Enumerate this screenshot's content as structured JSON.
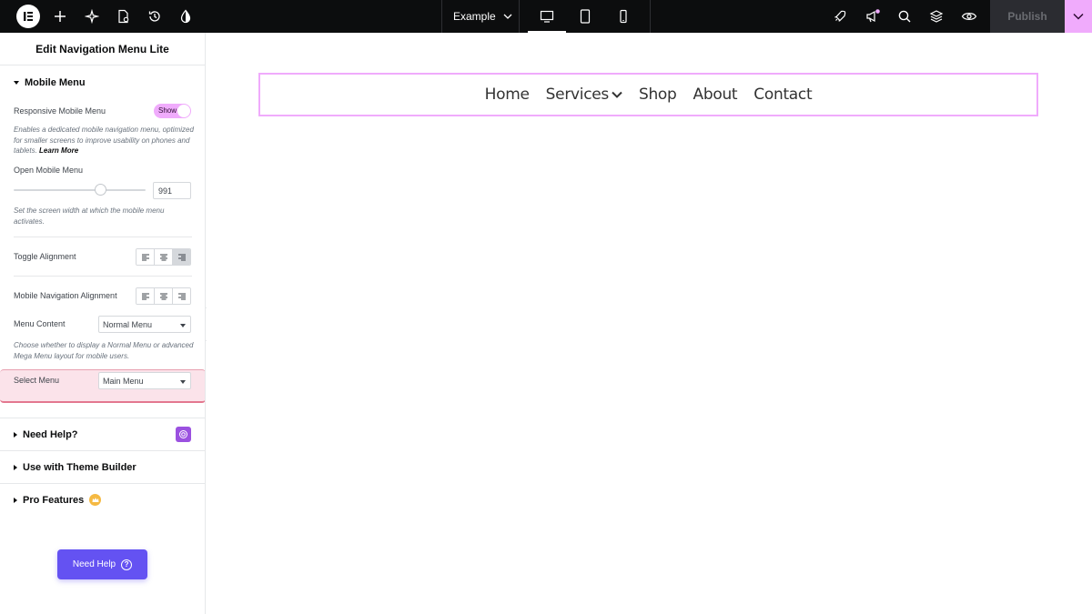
{
  "topbar": {
    "page_name": "Example",
    "publish_label": "Publish",
    "icons": [
      "elementor-logo-icon",
      "add-element-icon",
      "ai-sparkle-icon",
      "page-settings-icon",
      "history-icon",
      "site-settings-icon"
    ],
    "right_icons": [
      "rocket-icon",
      "announcements-icon",
      "search-icon",
      "structure-icon",
      "preview-icon"
    ],
    "devices": [
      "desktop-icon",
      "tablet-icon",
      "mobile-icon"
    ],
    "active_device": "desktop",
    "accent": "#f0abfc"
  },
  "panel": {
    "title": "Edit Navigation Menu Lite",
    "mobile_menu": {
      "title": "Mobile Menu",
      "responsive_label": "Responsive Mobile Menu",
      "responsive_toggle": "Show",
      "responsive_help": "Enables a dedicated mobile navigation menu, optimized for smaller screens to improve usability on phones and tablets.",
      "learn_more": "Learn More",
      "open_label": "Open Mobile Menu",
      "open_value": "991",
      "open_help": "Set the screen width at which the mobile menu activates.",
      "toggle_alignment_label": "Toggle Alignment",
      "toggle_alignment_active": "right",
      "mobile_nav_alignment_label": "Mobile Navigation Alignment",
      "menu_content_label": "Menu Content",
      "menu_content_value": "Normal Menu",
      "menu_content_help": "Choose whether to display a Normal Menu or advanced Mega Menu layout for mobile users.",
      "select_menu_label": "Select Menu",
      "select_menu_value": "Main Menu"
    },
    "sections": {
      "need_help": "Need Help?",
      "theme_builder": "Use with Theme Builder",
      "pro_features": "Pro Features"
    },
    "need_help_button": "Need Help",
    "need_help_q": "?"
  },
  "canvas": {
    "nav": [
      {
        "label": "Home"
      },
      {
        "label": "Services"
      },
      {
        "label": "Shop"
      },
      {
        "label": "About"
      },
      {
        "label": "Contact"
      }
    ]
  }
}
